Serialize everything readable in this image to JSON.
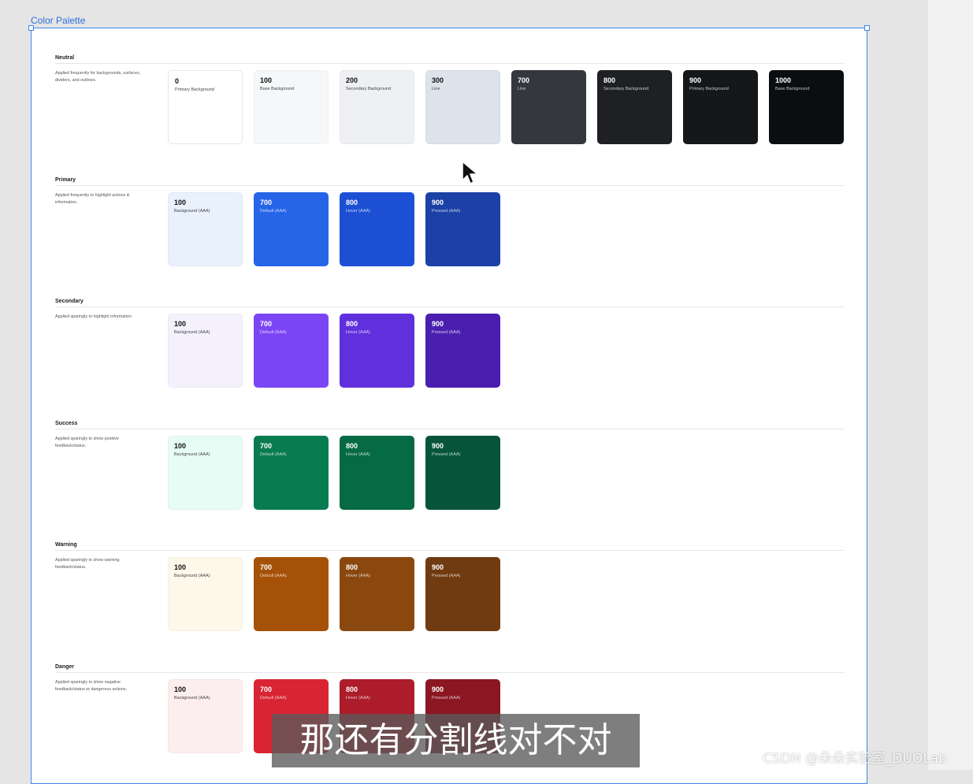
{
  "frame": {
    "label": "Color Palette"
  },
  "sections": [
    {
      "title": "Neutral",
      "description": "Applied frequently for backgrounds, surfaces, dividers, and outlines.",
      "swatches": [
        {
          "value": "0",
          "label": "Primary Background",
          "color": "#ffffff",
          "tone": "light",
          "border": true
        },
        {
          "value": "100",
          "label": "Base Background",
          "color": "#f5f7f8",
          "tone": "light"
        },
        {
          "value": "200",
          "label": "Secondary Background",
          "color": "#eef0f3",
          "tone": "light"
        },
        {
          "value": "300",
          "label": "Line",
          "color": "#dde3ea",
          "tone": "light"
        },
        {
          "value": "700",
          "label": "Line",
          "color": "#34373c",
          "tone": "dark"
        },
        {
          "value": "800",
          "label": "Secondary Background",
          "color": "#1e2024",
          "tone": "dark"
        },
        {
          "value": "900",
          "label": "Primary Background",
          "color": "#15181b",
          "tone": "dark"
        },
        {
          "value": "1000",
          "label": "Base Background",
          "color": "#0b0e10",
          "tone": "dark"
        }
      ]
    },
    {
      "title": "Primary",
      "description": "Applied frequently to highlight actions & information.",
      "swatches": [
        {
          "value": "100",
          "label": "Background (AAA)",
          "color": "#e9f1fd",
          "tone": "light"
        },
        {
          "value": "700",
          "label": "Default (AAA)",
          "color": "#2664e8",
          "tone": "dark"
        },
        {
          "value": "800",
          "label": "Hover (AAA)",
          "color": "#1c4fd4",
          "tone": "dark"
        },
        {
          "value": "900",
          "label": "Pressed (AAA)",
          "color": "#1b40a6",
          "tone": "dark"
        }
      ]
    },
    {
      "title": "Secondary",
      "description": "Applied sparingly to highlight information.",
      "swatches": [
        {
          "value": "100",
          "label": "Background (AAA)",
          "color": "#f4f1fd",
          "tone": "light"
        },
        {
          "value": "700",
          "label": "Default (AAA)",
          "color": "#7c45f3",
          "tone": "dark"
        },
        {
          "value": "800",
          "label": "Hover (AAA)",
          "color": "#6130dd",
          "tone": "dark"
        },
        {
          "value": "900",
          "label": "Pressed (AAA)",
          "color": "#4a1fb0",
          "tone": "dark"
        }
      ]
    },
    {
      "title": "Success",
      "description": "Applied sparingly to show positive feedback/status.",
      "swatches": [
        {
          "value": "100",
          "label": "Background (AAA)",
          "color": "#e7fcf4",
          "tone": "light"
        },
        {
          "value": "700",
          "label": "Default (AAA)",
          "color": "#097b50",
          "tone": "dark"
        },
        {
          "value": "800",
          "label": "Hover (AAA)",
          "color": "#066a45",
          "tone": "dark"
        },
        {
          "value": "900",
          "label": "Pressed (AAA)",
          "color": "#06553a",
          "tone": "dark"
        }
      ]
    },
    {
      "title": "Warning",
      "description": "Applied sparingly to show  warning feedback/status.",
      "swatches": [
        {
          "value": "100",
          "label": "Background (AAA)",
          "color": "#fdf8ea",
          "tone": "light"
        },
        {
          "value": "700",
          "label": "Default (AAA)",
          "color": "#a55208",
          "tone": "dark"
        },
        {
          "value": "800",
          "label": "Hover (AAA)",
          "color": "#8a480f",
          "tone": "dark"
        },
        {
          "value": "900",
          "label": "Pressed (AAA)",
          "color": "#703b10",
          "tone": "dark"
        }
      ]
    },
    {
      "title": "Danger",
      "description": "Applied sparingly to show  negative feedback/status or dangerous actions.",
      "swatches": [
        {
          "value": "100",
          "label": "Background (AAA)",
          "color": "#fcedee",
          "tone": "light"
        },
        {
          "value": "700",
          "label": "Default (AAA)",
          "color": "#d92533",
          "tone": "dark"
        },
        {
          "value": "800",
          "label": "Hover (AAA)",
          "color": "#ac1c2a",
          "tone": "dark"
        },
        {
          "value": "900",
          "label": "Pressed (AAA)",
          "color": "#8b1722",
          "tone": "dark"
        }
      ]
    }
  ],
  "overlay": {
    "subtitle": "那还有分割线对不对",
    "watermark": "CSDN @朵朵实验室_DUOLab"
  }
}
